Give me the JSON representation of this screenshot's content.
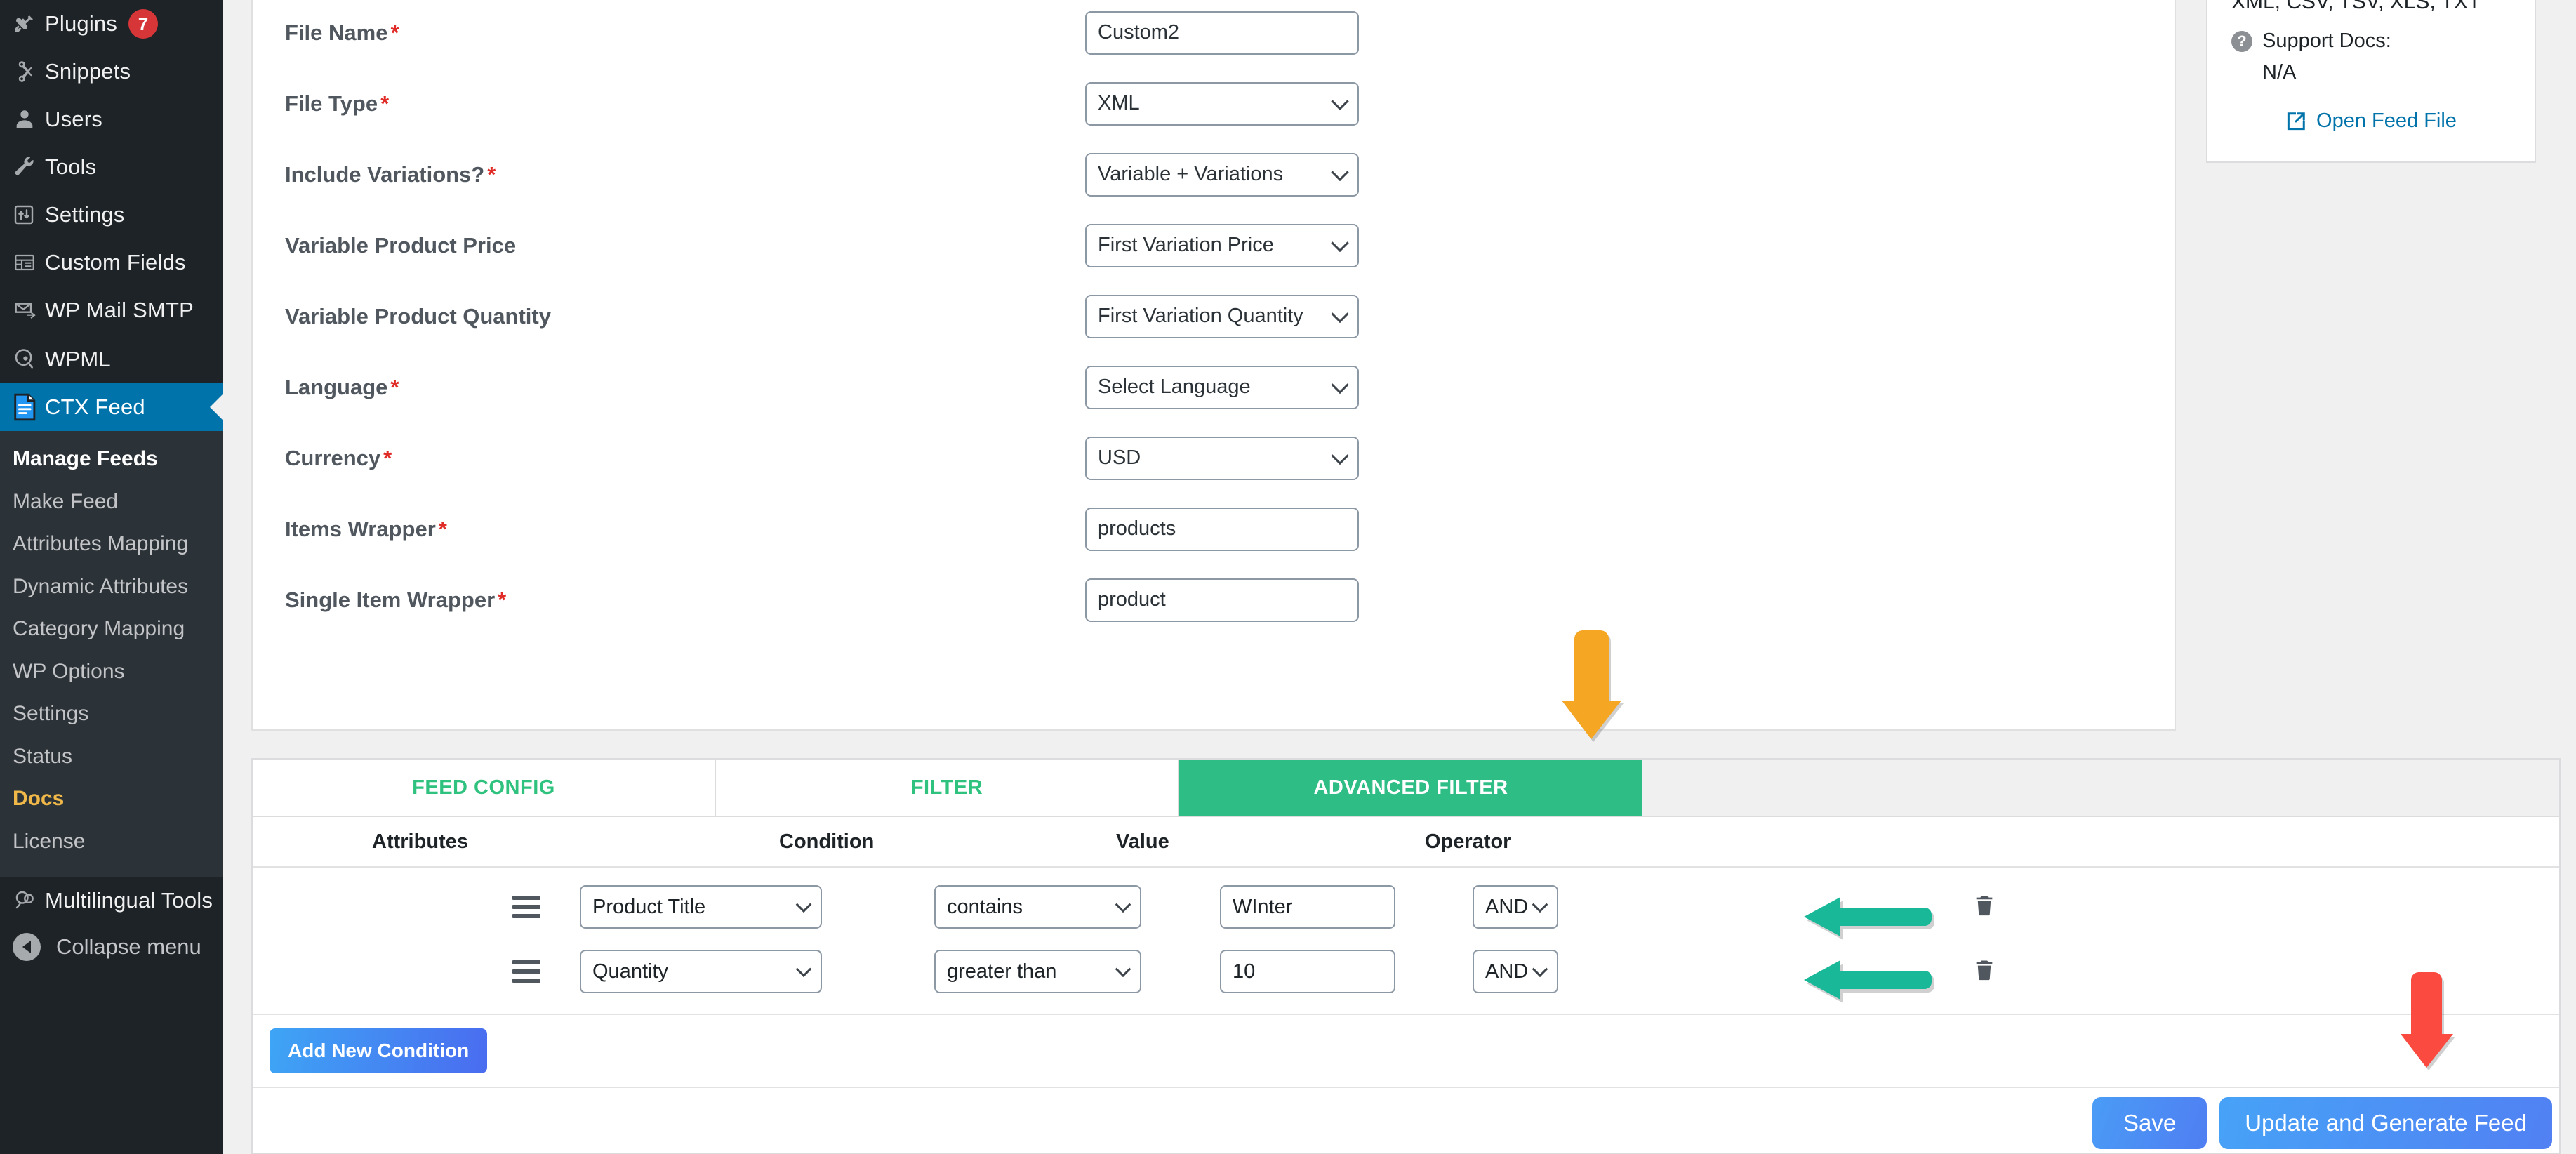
{
  "sidebar": {
    "menu": [
      {
        "label": "Plugins",
        "icon": "plug-icon",
        "badge": "7"
      },
      {
        "label": "Snippets",
        "icon": "scissors-icon",
        "badge": ""
      },
      {
        "label": "Users",
        "icon": "user-icon",
        "badge": ""
      },
      {
        "label": "Tools",
        "icon": "wrench-icon",
        "badge": ""
      },
      {
        "label": "Settings",
        "icon": "sliders-icon",
        "badge": ""
      },
      {
        "label": "Custom Fields",
        "icon": "table-icon",
        "badge": ""
      },
      {
        "label": "WP Mail SMTP",
        "icon": "mail-icon",
        "badge": ""
      },
      {
        "label": "WPML",
        "icon": "globe-icon",
        "badge": ""
      },
      {
        "label": "CTX Feed",
        "icon": "document-icon",
        "badge": "",
        "active": true
      }
    ],
    "submenu": [
      {
        "label": "Manage Feeds",
        "state": "current"
      },
      {
        "label": "Make Feed",
        "state": ""
      },
      {
        "label": "Attributes Mapping",
        "state": ""
      },
      {
        "label": "Dynamic Attributes",
        "state": ""
      },
      {
        "label": "Category Mapping",
        "state": ""
      },
      {
        "label": "WP Options",
        "state": ""
      },
      {
        "label": "Settings",
        "state": ""
      },
      {
        "label": "Status",
        "state": ""
      },
      {
        "label": "Docs",
        "state": "highlight"
      },
      {
        "label": "License",
        "state": ""
      }
    ],
    "multilingual_tools": "Multilingual Tools",
    "collapse_menu": "Collapse menu"
  },
  "form": {
    "rows": [
      {
        "label": "File Name",
        "required": true,
        "type": "text",
        "value": "Custom2"
      },
      {
        "label": "File Type",
        "required": true,
        "type": "select",
        "value": "XML"
      },
      {
        "label": "Include Variations?",
        "required": true,
        "type": "select",
        "value": "Variable + Variations"
      },
      {
        "label": "Variable Product Price",
        "required": false,
        "type": "select",
        "value": "First Variation Price"
      },
      {
        "label": "Variable Product Quantity",
        "required": false,
        "type": "select",
        "value": "First Variation Quantity"
      },
      {
        "label": "Language",
        "required": true,
        "type": "select",
        "value": "Select Language"
      },
      {
        "label": "Currency",
        "required": true,
        "type": "select",
        "value": "USD"
      },
      {
        "label": "Items Wrapper",
        "required": true,
        "type": "text",
        "value": "products"
      },
      {
        "label": "Single Item Wrapper",
        "required": true,
        "type": "text",
        "value": "product"
      }
    ]
  },
  "side_panel": {
    "formats": "XML, CSV, TSV, XLS, TXT",
    "support_docs_label": "Support Docs:",
    "support_docs_value": "N/A",
    "open_feed_file": "Open Feed File"
  },
  "tabs": [
    {
      "label": "FEED CONFIG",
      "active": false
    },
    {
      "label": "FILTER",
      "active": false
    },
    {
      "label": "ADVANCED FILTER",
      "active": true
    }
  ],
  "table": {
    "headers": {
      "attributes": "Attributes",
      "condition": "Condition",
      "value": "Value",
      "operator": "Operator"
    },
    "rows": [
      {
        "attribute": "Product Title",
        "condition": "contains",
        "value": "WInter",
        "operator": "AND"
      },
      {
        "attribute": "Quantity",
        "condition": "greater than",
        "value": "10",
        "operator": "AND"
      }
    ]
  },
  "buttons": {
    "add_new_condition": "Add New Condition",
    "save": "Save",
    "update_and_generate": "Update and Generate Feed"
  },
  "colors": {
    "sidebar_bg": "#1d2327",
    "sidebar_active": "#0073aa",
    "tab_green": "#2ebd85",
    "docs_highlight": "#f0b849",
    "link_blue": "#0073aa",
    "required_red": "#e02b27",
    "arrow_orange": "#f5a623",
    "arrow_red": "#fb4a3f",
    "arrow_teal": "#18b899",
    "button_blue": "#4a9cf6"
  }
}
